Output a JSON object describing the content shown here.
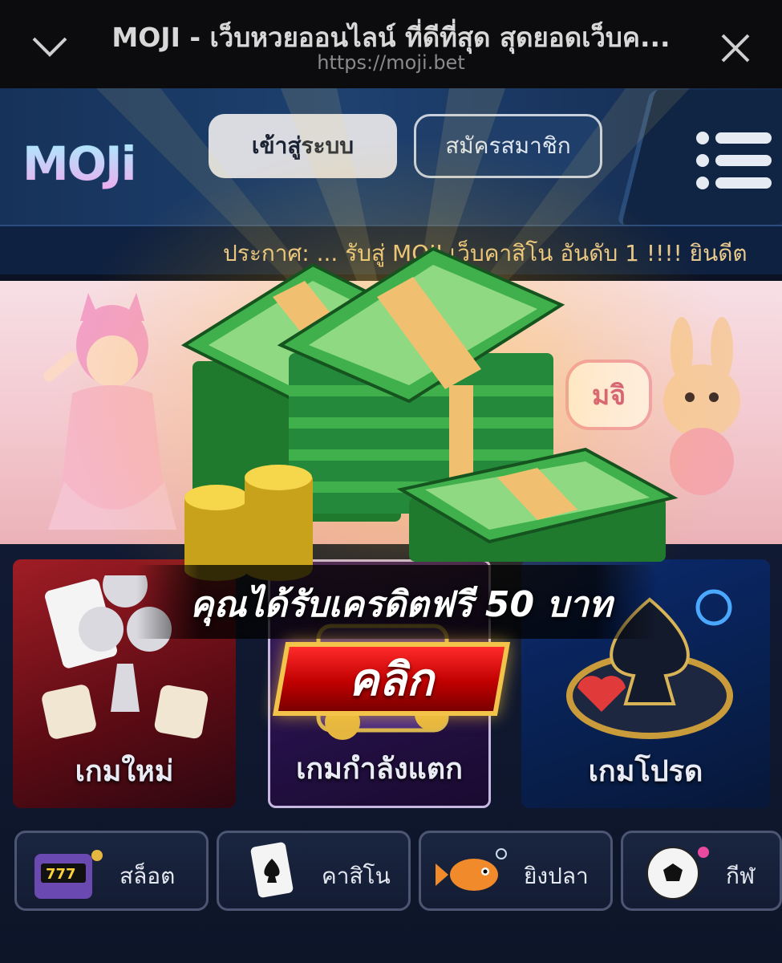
{
  "browser": {
    "title": "MOJI - เว็บหวยออนไลน์ ที่ดีที่สุด สุดยอดเว็บค...",
    "url": "https://moji.bet"
  },
  "header": {
    "logo_text": "MOJi",
    "login_label": "เข้าสู่ระบบ",
    "register_label": "สมัครสมาชิก",
    "announcement": "ประกาศ: ... รับสู่ MOJI เว็บคาสิโน อันดับ 1 !!!! ยินดีต"
  },
  "banner": {
    "badge_text": "มจิ"
  },
  "game_cards": [
    {
      "label": "เกมใหม่"
    },
    {
      "label": "เกมกำลังแตก"
    },
    {
      "label": "เกมโปรด"
    }
  ],
  "categories": [
    {
      "label": "สล็อต"
    },
    {
      "label": "คาสิโน"
    },
    {
      "label": "ยิงปลา"
    },
    {
      "label": "กีฬ"
    }
  ],
  "promo": {
    "text": "คุณได้รับเครดิตฟรี 50 บาท",
    "button_label": "คลิก"
  },
  "colors": {
    "promo_red": "#c00000",
    "promo_gold": "#f3c34a",
    "header_blue": "#1e4170"
  }
}
